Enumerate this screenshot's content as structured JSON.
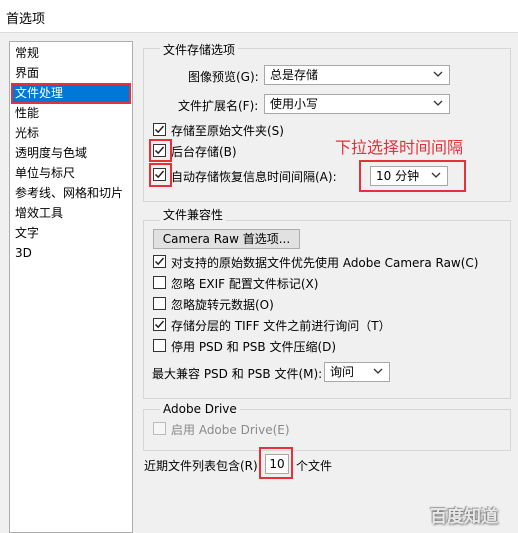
{
  "window": {
    "title": "首选项"
  },
  "sidebar": {
    "items": [
      {
        "label": "常规"
      },
      {
        "label": "界面"
      },
      {
        "label": "文件处理"
      },
      {
        "label": "性能"
      },
      {
        "label": "光标"
      },
      {
        "label": "透明度与色域"
      },
      {
        "label": "单位与标尺"
      },
      {
        "label": "参考线、网格和切片"
      },
      {
        "label": "增效工具"
      },
      {
        "label": "文字"
      },
      {
        "label": "3D"
      }
    ],
    "selected": "文件处理"
  },
  "file_save": {
    "legend": "文件存储选项",
    "image_preview_label": "图像预览(G):",
    "image_preview_value": "总是存储",
    "extension_label": "文件扩展名(F):",
    "extension_value": "使用小写",
    "save_to_original_folder": {
      "label": "存储至原始文件夹(S)",
      "checked": true
    },
    "background_save": {
      "label": "后台存储(B)",
      "checked": true
    },
    "auto_save": {
      "label": "自动存储恢复信息时间间隔(A):",
      "checked": true
    },
    "auto_save_interval": "10 分钟",
    "annotation": "下拉选择时间间隔"
  },
  "compat": {
    "legend": "文件兼容性",
    "camera_raw_button": "Camera Raw 首选项...",
    "items": [
      {
        "label": "对支持的原始数据文件优先使用 Adobe Camera Raw(C)",
        "checked": true
      },
      {
        "label": "忽略 EXIF 配置文件标记(X)",
        "checked": false
      },
      {
        "label": "忽略旋转元数据(O)",
        "checked": false
      },
      {
        "label": "存储分层的 TIFF 文件之前进行询问（T）",
        "checked": true
      },
      {
        "label": "停用 PSD 和 PSB 文件压缩(D)",
        "checked": false
      }
    ],
    "max_compat_label": "最大兼容 PSD 和 PSB 文件(M):",
    "max_compat_value": "询问"
  },
  "adobe_drive": {
    "legend": "Adobe Drive",
    "enable_label": "启用 Adobe Drive(E)",
    "checked": false,
    "disabled": true
  },
  "recent_files": {
    "label": "近期文件列表包含(R):",
    "value": "10",
    "suffix": "个文件"
  },
  "watermark": "百度知道",
  "colors": {
    "accent": "#0078d7",
    "annotation_red": "#e8303a",
    "background": "#f0f0f0"
  }
}
